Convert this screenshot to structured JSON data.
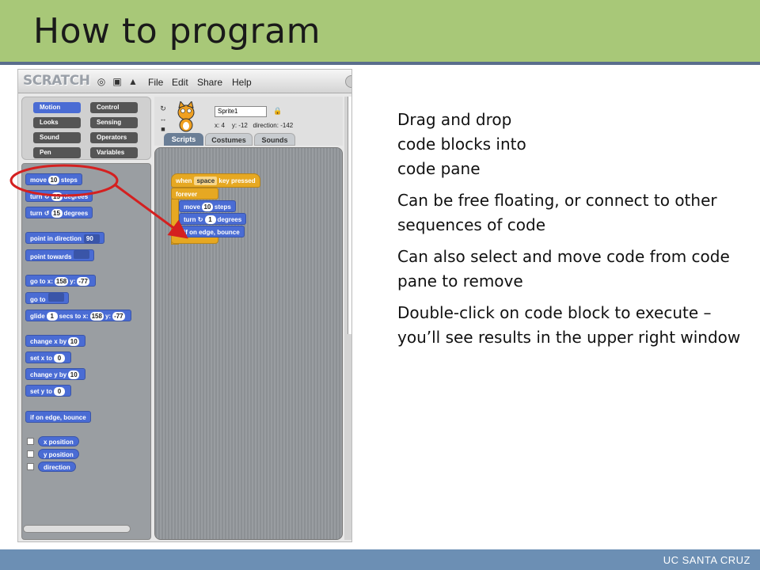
{
  "slide": {
    "title": "How to program",
    "footer": "UC SANTA CRUZ",
    "bullets": [
      "Drag and drop code blocks into code pane",
      "Can be free floating, or connect to other sequences of code",
      "Can also select and move code from code pane to remove",
      "Double-click on code block to execute – you’ll see results in the upper right window"
    ]
  },
  "scratch": {
    "logo": "SCRATCH",
    "menu": [
      "File",
      "Edit",
      "Share",
      "Help"
    ],
    "categories": [
      "Motion",
      "Control",
      "Looks",
      "Sensing",
      "Sound",
      "Operators",
      "Pen",
      "Variables"
    ],
    "palette": {
      "move": {
        "pre": "move",
        "val": "10",
        "post": "steps"
      },
      "turn_cw": {
        "pre": "turn",
        "glyph": "↻",
        "val": "15",
        "post": "degrees"
      },
      "turn_ccw": {
        "pre": "turn",
        "glyph": "↺",
        "val": "15",
        "post": "degrees"
      },
      "point_dir": {
        "pre": "point in direction",
        "val": "90"
      },
      "point_towards": {
        "pre": "point towards"
      },
      "goto_xy": {
        "pre": "go to x:",
        "x": "158",
        "ylabel": "y:",
        "y": "-77"
      },
      "goto": {
        "pre": "go to"
      },
      "glide": {
        "pre": "glide",
        "secs": "1",
        "mid": "secs to x:",
        "x": "158",
        "ylabel": "y:",
        "y": "-77"
      },
      "change_x": {
        "pre": "change x by",
        "val": "10"
      },
      "set_x": {
        "pre": "set x to",
        "val": "0"
      },
      "change_y": {
        "pre": "change y by",
        "val": "10"
      },
      "set_y": {
        "pre": "set y to",
        "val": "0"
      },
      "bounce": "if on edge, bounce",
      "x_position": "x position",
      "y_position": "y position",
      "direction": "direction"
    },
    "sprite": {
      "name": "Sprite1",
      "x_label": "x:",
      "x": "4",
      "y_label": "y:",
      "y": "-12",
      "dir_label": "direction:",
      "direction": "-142"
    },
    "tabs": [
      "Scripts",
      "Costumes",
      "Sounds"
    ],
    "script": {
      "hat": {
        "pre": "when",
        "key": "space",
        "post": "key pressed"
      },
      "forever": "forever",
      "move": {
        "pre": "move",
        "val": "10",
        "post": "steps"
      },
      "turn": {
        "pre": "turn",
        "glyph": "↻",
        "val": "1",
        "post": "degrees"
      },
      "bounce": "if on edge, bounce"
    }
  },
  "colors": {
    "title_bar": "#a8c878",
    "footer_bar": "#6c8fb4",
    "motion": "#4a6cd4",
    "control": "#e6a822",
    "annotation": "#d42020"
  }
}
